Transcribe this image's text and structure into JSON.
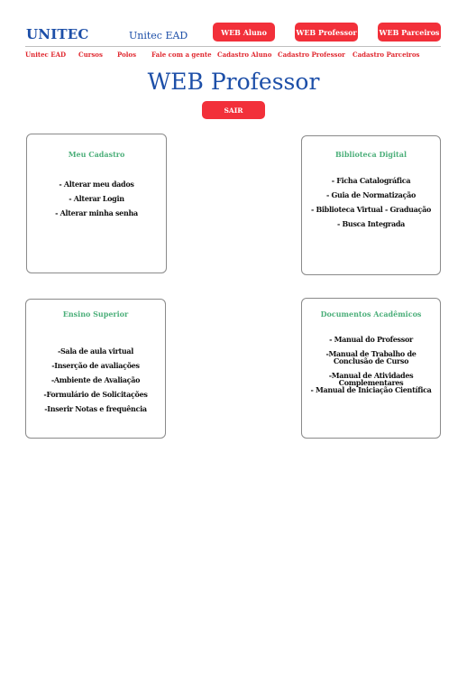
{
  "header": {
    "brand": "UNITEC",
    "brand_sub": "Unitec EAD",
    "buttons": [
      "WEB Aluno",
      "WEB Professor",
      "WEB Parceiros"
    ]
  },
  "nav": {
    "items": [
      "Unitec EAD",
      "Cursos",
      "Polos",
      "Fale com a gente",
      "Cadastro Aluno",
      "Cadastro Professor",
      "Cadastro Parceiros"
    ]
  },
  "main": {
    "title": "WEB Professor",
    "logout_label": "SAIR"
  },
  "cards": {
    "meu_cadastro": {
      "title": "Meu Cadastro",
      "links": [
        "- Alterar meu dados",
        "- Alterar Login",
        "- Alterar minha senha"
      ]
    },
    "biblioteca": {
      "title": "Biblioteca Digital",
      "links": [
        "- Ficha Catalográfica",
        "- Guia de Normatização",
        "- Biblioteca Virtual - Graduação",
        "- Busca Integrada"
      ]
    },
    "ensino": {
      "title": "Ensino Superior",
      "links": [
        "-Sala de aula virtual",
        "-Inserção de avaliações",
        "-Ambiente de Avaliação",
        "-Formulário de Solicitações",
        "-Inserir Notas e frequência"
      ]
    },
    "documentos": {
      "title": "Documentos Acadêmicos",
      "links": [
        "- Manual do Professor",
        "-Manual de Trabalho de Conclusão de Curso",
        "-Manual de Atividades Complementares",
        "- Manual de Iniciação Científica"
      ]
    }
  },
  "colors": {
    "brand_blue": "#1d4fa8",
    "accent_red": "#f2303a",
    "card_title_green": "#4caf7a"
  }
}
